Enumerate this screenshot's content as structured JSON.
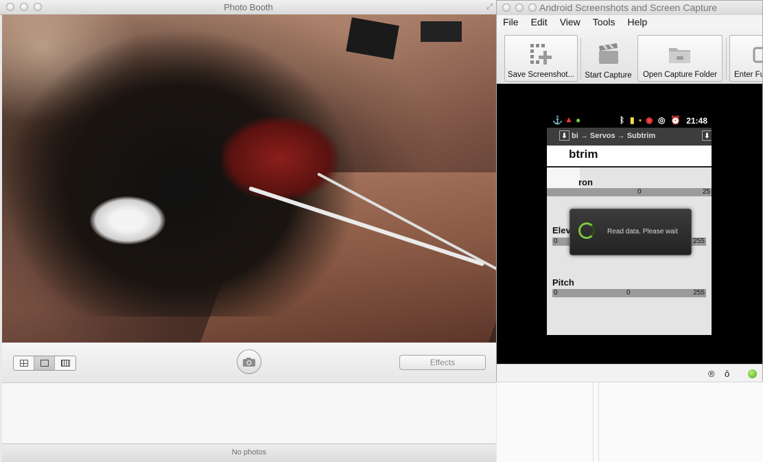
{
  "photo_booth": {
    "title": "Photo Booth",
    "view_modes": [
      "four-up-icon",
      "single-photo-icon",
      "movie-clip-icon"
    ],
    "effects_label": "Effects",
    "status": "No photos"
  },
  "capture_app": {
    "title": "Android Screenshots and Screen Capture",
    "menu": [
      "File",
      "Edit",
      "View",
      "Tools",
      "Help"
    ],
    "toolbar": [
      {
        "label": "Save Screenshot...",
        "icon": "save-screenshot-icon"
      },
      {
        "label": "Start Capture",
        "icon": "clapperboard-icon"
      },
      {
        "label": "Open Capture Folder",
        "icon": "folder-icon"
      },
      {
        "label": "Enter Fu",
        "icon": "fullscreen-icon"
      }
    ],
    "status_icons": [
      "®",
      "ô"
    ],
    "phone": {
      "time": "21:48",
      "breadcrumb": "bi → Servos → Subtrim",
      "header": "btrim",
      "sections": [
        {
          "label": "ron",
          "min": "",
          "mid": "0",
          "max": "25"
        },
        {
          "label": "Elev",
          "min": "0",
          "mid": "",
          "max": "255"
        },
        {
          "label": "Pitch",
          "min": "0",
          "mid": "0",
          "max": "255"
        }
      ],
      "dialog_text": "Read data. Please wait"
    }
  }
}
